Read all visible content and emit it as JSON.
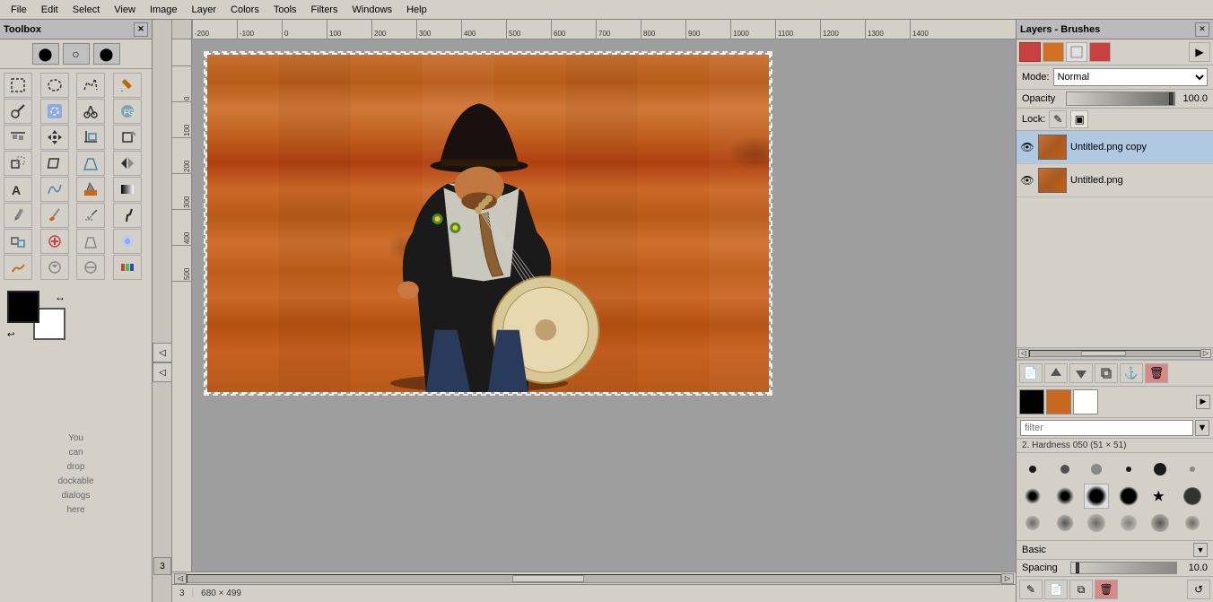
{
  "menubar": {
    "items": [
      "File",
      "Edit",
      "Select",
      "View",
      "Image",
      "Layer",
      "Colors",
      "Tools",
      "Filters",
      "Windows",
      "Help"
    ]
  },
  "toolbox": {
    "title": "Toolbox",
    "tools": [
      {
        "icon": "⬜",
        "name": "rect-select",
        "title": "Rectangle Select"
      },
      {
        "icon": "◯",
        "name": "ellipse-select",
        "title": "Ellipse Select"
      },
      {
        "icon": "⌖",
        "name": "free-select",
        "title": "Free Select"
      },
      {
        "icon": "✏️",
        "name": "pencil",
        "title": "Pencil"
      },
      {
        "icon": "✂",
        "name": "scissors-select",
        "title": "Scissors Select"
      },
      {
        "icon": "🖊",
        "name": "paths",
        "title": "Paths"
      },
      {
        "icon": "🔠",
        "name": "text",
        "title": "Text"
      },
      {
        "icon": "🖌",
        "name": "clone",
        "title": "Clone"
      },
      {
        "icon": "🔍",
        "name": "zoom",
        "title": "Zoom"
      },
      {
        "icon": "🖍",
        "name": "paintbrush",
        "title": "Paintbrush"
      },
      {
        "icon": "↕",
        "name": "move",
        "title": "Move"
      },
      {
        "icon": "✛",
        "name": "align",
        "title": "Align"
      },
      {
        "icon": "⊕",
        "name": "transform",
        "title": "Transform"
      },
      {
        "icon": "💧",
        "name": "color-pick",
        "title": "Color Pick"
      },
      {
        "icon": "🔬",
        "name": "magnify",
        "title": "Magnify"
      },
      {
        "icon": "◈",
        "name": "crop",
        "title": "Crop"
      },
      {
        "icon": "A",
        "name": "text2",
        "title": "Text"
      },
      {
        "icon": "☁",
        "name": "fuzzy-select",
        "title": "Fuzzy Select"
      },
      {
        "icon": "▣",
        "name": "rect-fill",
        "title": "Bucket Fill"
      },
      {
        "icon": "🖊",
        "name": "ink",
        "title": "Ink"
      },
      {
        "icon": "✦",
        "name": "heal",
        "title": "Heal"
      },
      {
        "icon": "❖",
        "name": "smudge",
        "title": "Smudge"
      },
      {
        "icon": "🔶",
        "name": "dodge",
        "title": "Dodge/Burn"
      },
      {
        "icon": "✳",
        "name": "convolve",
        "title": "Convolve"
      },
      {
        "icon": "↗",
        "name": "flip",
        "title": "Flip"
      },
      {
        "icon": "⊞",
        "name": "blend",
        "title": "Blend"
      },
      {
        "icon": "🔁",
        "name": "rotate",
        "title": "Rotate"
      },
      {
        "icon": "👁",
        "name": "layer-ops",
        "title": "Layer Operations"
      },
      {
        "icon": "💦",
        "name": "blur",
        "title": "Blur"
      },
      {
        "icon": "~",
        "name": "warp",
        "title": "Warp Transform"
      },
      {
        "icon": "♾",
        "name": "cage",
        "title": "Cage Transform"
      },
      {
        "icon": "⋯",
        "name": "measure",
        "title": "Measure"
      }
    ],
    "fg_color": "#000000",
    "bg_color": "#ffffff",
    "drop_hint": "You\ncan\ndrop\ndockable\ndialogs\nhere"
  },
  "layers_panel": {
    "title": "Layers - Brushes",
    "mode_label": "Mode:",
    "mode_value": "Normal",
    "opacity_label": "Opacity",
    "opacity_value": "100.0",
    "lock_label": "Lock:",
    "layers": [
      {
        "name": "Untitled.png copy",
        "visible": true,
        "active": true
      },
      {
        "name": "Untitled.png",
        "visible": true,
        "active": false
      }
    ],
    "brushes": {
      "filter_placeholder": "filter",
      "brush_name": "2. Hardness 050 (51 × 51)",
      "category": "Basic",
      "spacing_label": "Spacing",
      "spacing_value": "10.0"
    }
  },
  "canvas": {
    "title": "Untitled.png",
    "ruler_h_marks": [
      "-200",
      "-100",
      "0",
      "100",
      "200",
      "300",
      "400",
      "500",
      "600",
      "700",
      "800",
      "900",
      "1000",
      "1100",
      "1200",
      "1300",
      "1400"
    ],
    "ruler_v_marks": [
      "",
      "0",
      "100",
      "200",
      "300",
      "400",
      "500"
    ]
  },
  "status_bar": {
    "zoom": "3",
    "coordinates": "680 × 499"
  }
}
